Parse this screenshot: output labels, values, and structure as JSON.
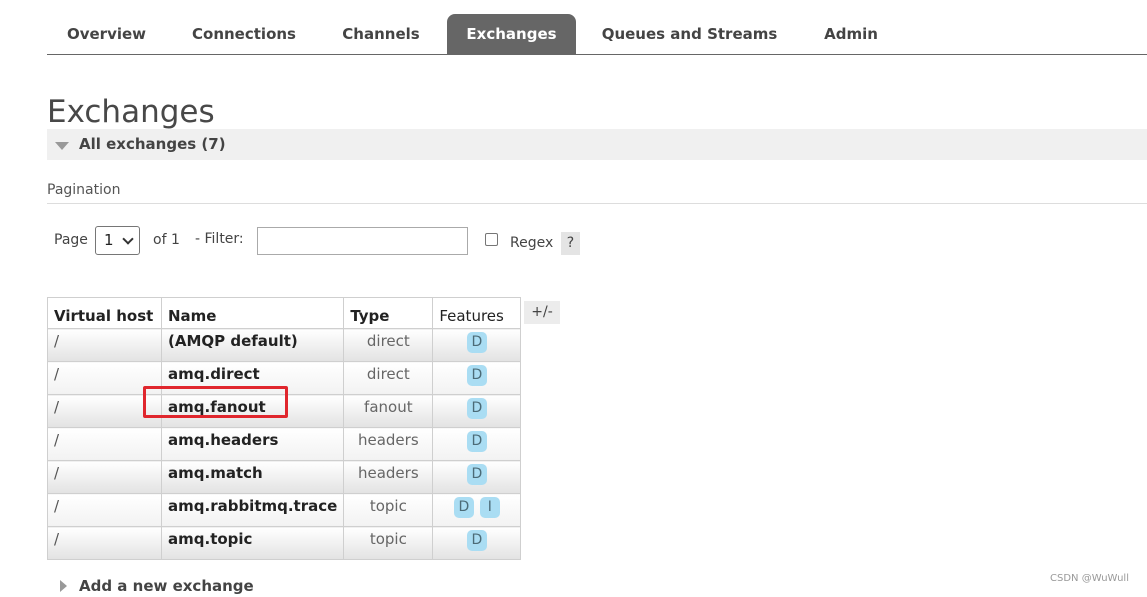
{
  "nav": {
    "tabs": [
      {
        "label": "Overview",
        "active": false
      },
      {
        "label": "Connections",
        "active": false
      },
      {
        "label": "Channels",
        "active": false
      },
      {
        "label": "Exchanges",
        "active": true
      },
      {
        "label": "Queues and Streams",
        "active": false
      },
      {
        "label": "Admin",
        "active": false
      }
    ]
  },
  "page": {
    "title": "Exchanges",
    "section_label": "All exchanges (7)"
  },
  "pagination": {
    "heading": "Pagination",
    "page_label": "Page",
    "page_value": "1",
    "of_label": "of 1",
    "filter_label": "- Filter:",
    "filter_value": "",
    "regex_label": "Regex",
    "regex_checked": false,
    "help_label": "?"
  },
  "table": {
    "columns": [
      "Virtual host",
      "Name",
      "Type",
      "Features"
    ],
    "toggle_label": "+/-",
    "rows": [
      {
        "vhost": "/",
        "name": "(AMQP default)",
        "type": "direct",
        "features": [
          "D"
        ]
      },
      {
        "vhost": "/",
        "name": "amq.direct",
        "type": "direct",
        "features": [
          "D"
        ]
      },
      {
        "vhost": "/",
        "name": "amq.fanout",
        "type": "fanout",
        "features": [
          "D"
        ],
        "highlighted": true
      },
      {
        "vhost": "/",
        "name": "amq.headers",
        "type": "headers",
        "features": [
          "D"
        ]
      },
      {
        "vhost": "/",
        "name": "amq.match",
        "type": "headers",
        "features": [
          "D"
        ]
      },
      {
        "vhost": "/",
        "name": "amq.rabbitmq.trace",
        "type": "topic",
        "features": [
          "D",
          "I"
        ]
      },
      {
        "vhost": "/",
        "name": "amq.topic",
        "type": "topic",
        "features": [
          "D"
        ]
      }
    ]
  },
  "add_section": {
    "label": "Add a new exchange"
  },
  "watermark": "CSDN @WuWull",
  "colors": {
    "active_tab": "#666666",
    "badge": "#aaddf3",
    "highlight": "#e0262d"
  },
  "icons": {
    "section_toggle": "triangle-down-icon",
    "add_toggle": "triangle-right-icon"
  }
}
